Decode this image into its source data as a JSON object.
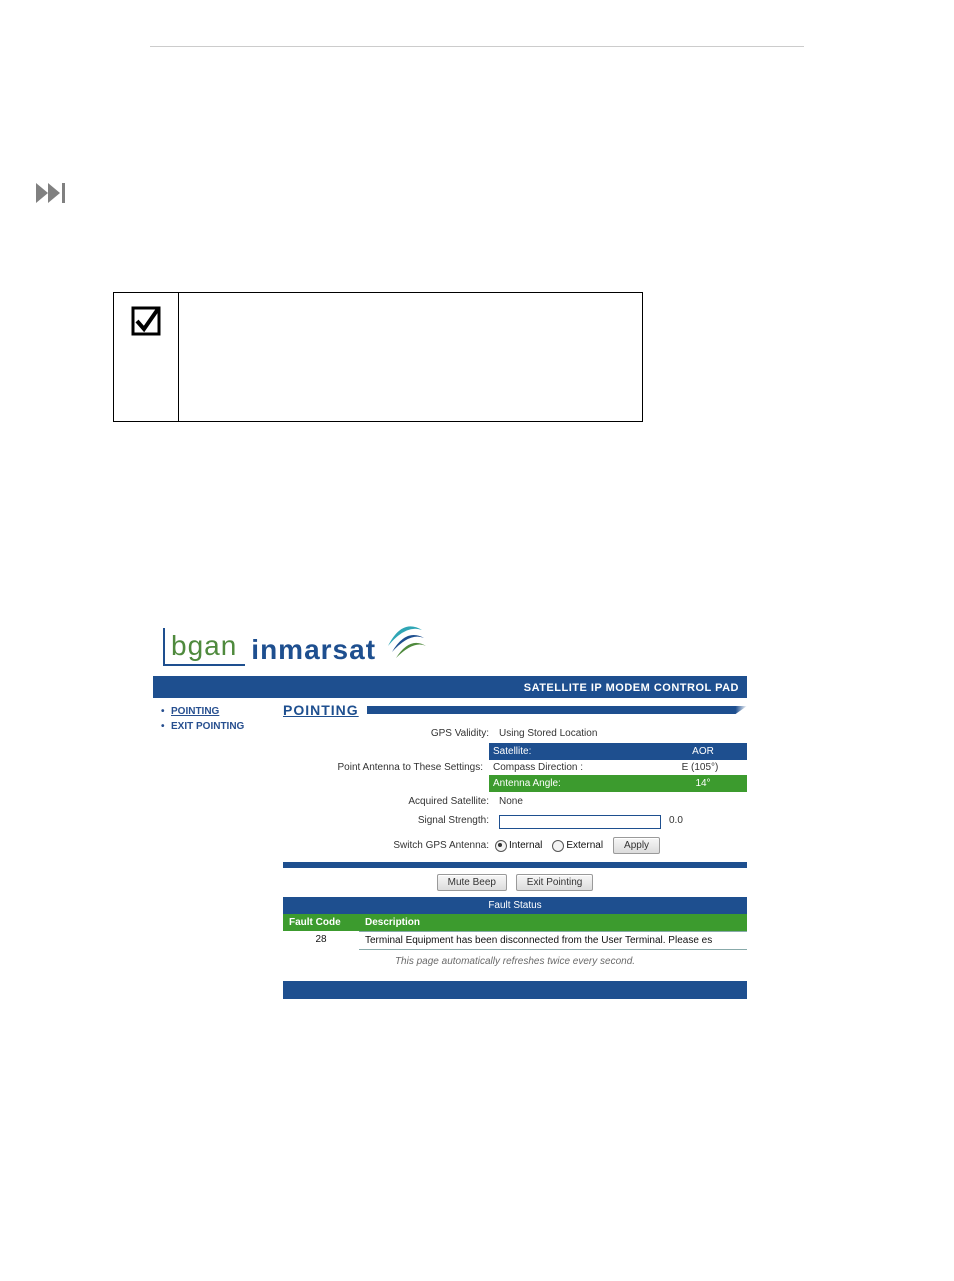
{
  "app": {
    "title_bar": "SATELLITE IP MODEM CONTROL PAD"
  },
  "logo": {
    "bgan": "bgan",
    "inmarsat": "inmarsat"
  },
  "sidebar": {
    "items": [
      "POINTING",
      "EXIT POINTING"
    ]
  },
  "section": {
    "title": "POINTING"
  },
  "fields": {
    "gps_validity_label": "GPS Validity:",
    "gps_validity_value": "Using Stored Location",
    "point_label": "Point Antenna to These Settings:",
    "satellite_label": "Satellite:",
    "satellite_value": "AOR",
    "compass_label": "Compass Direction :",
    "compass_value": "E (105°)",
    "angle_label": "Antenna Angle:",
    "angle_value": "14°",
    "acquired_label": "Acquired Satellite:",
    "acquired_value": "None",
    "strength_label": "Signal Strength:",
    "strength_value": "0.0",
    "switch_label": "Switch GPS Antenna:",
    "radio_internal": "Internal",
    "radio_external": "External",
    "apply_btn": "Apply",
    "mute_btn": "Mute Beep",
    "exit_btn": "Exit Pointing"
  },
  "fault": {
    "status_label": "Fault Status",
    "code_head": "Fault Code",
    "desc_head": "Description",
    "row_code": "28",
    "row_desc": "Terminal Equipment has been disconnected from the User Terminal.  Please es"
  },
  "footer_note": "This page automatically refreshes twice every second."
}
